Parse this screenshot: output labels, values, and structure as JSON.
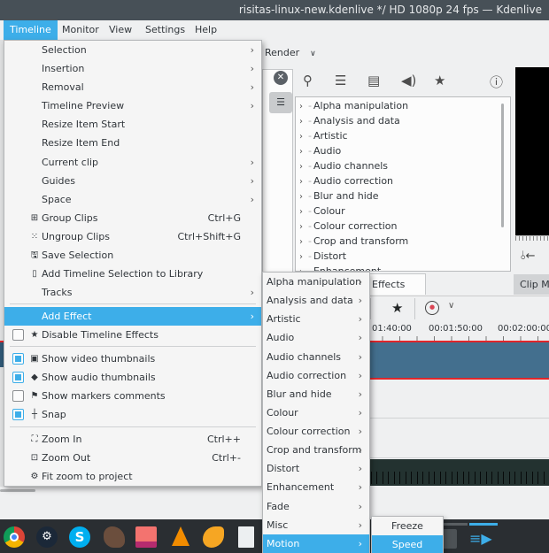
{
  "window": {
    "title": "risitas-linux-new.kdenlive */ HD 1080p 24 fps — Kdenlive"
  },
  "menubar": [
    {
      "label": "Timeline",
      "active": true
    },
    {
      "label": "Monitor"
    },
    {
      "label": "View"
    },
    {
      "label": "Settings"
    },
    {
      "label": "Help"
    }
  ],
  "toolbar": {
    "render_label": "Render"
  },
  "effects_panel": {
    "categories": [
      "Alpha manipulation",
      "Analysis and data",
      "Artistic",
      "Audio",
      "Audio channels",
      "Audio correction",
      "Blur and hide",
      "Colour",
      "Colour correction",
      "Crop and transform",
      "Distort",
      "Enhancement"
    ],
    "icons": [
      "search-icon",
      "list-icon",
      "video-icon",
      "audio-icon",
      "favorite-icon",
      "info-icon"
    ]
  },
  "tabs": {
    "effects": "Effects",
    "clip_monitor": "Clip Monitor"
  },
  "timeline": {
    "ruler_labels": [
      "01:40:00",
      "00:01:50:00",
      "00:02:00:00"
    ]
  },
  "timeline_menu": {
    "items": [
      {
        "label": "Selection",
        "submenu": true
      },
      {
        "label": "Insertion",
        "submenu": true
      },
      {
        "label": "Removal",
        "submenu": true
      },
      {
        "label": "Timeline Preview",
        "submenu": true
      },
      {
        "label": "Resize Item Start"
      },
      {
        "label": "Resize Item End"
      },
      {
        "label": "Current clip",
        "submenu": true
      },
      {
        "label": "Guides",
        "submenu": true
      },
      {
        "label": "Space",
        "submenu": true
      },
      {
        "label": "Group Clips",
        "shortcut": "Ctrl+G",
        "icon": "group-icon"
      },
      {
        "label": "Ungroup Clips",
        "shortcut": "Ctrl+Shift+G",
        "icon": "ungroup-icon"
      },
      {
        "label": "Save Selection",
        "icon": "save-icon"
      },
      {
        "label": "Add Timeline Selection to Library",
        "icon": "bookmark-icon"
      },
      {
        "label": "Tracks",
        "submenu": true
      },
      {
        "label": "Add Effect",
        "submenu": true,
        "highlighted": true
      },
      {
        "label": "Disable Timeline Effects",
        "checkbox": false,
        "icon": "star-icon"
      },
      {
        "label": "Show video thumbnails",
        "checkbox": true,
        "icon": "film-icon"
      },
      {
        "label": "Show audio thumbnails",
        "checkbox": true,
        "icon": "audio-wave-icon"
      },
      {
        "label": "Show markers comments",
        "checkbox": false,
        "icon": "flag-icon"
      },
      {
        "label": "Snap",
        "checkbox": true,
        "icon": "snap-icon"
      },
      {
        "label": "Zoom In",
        "shortcut": "Ctrl++",
        "icon": "zoom-in-icon"
      },
      {
        "label": "Zoom Out",
        "shortcut": "Ctrl+-",
        "icon": "zoom-out-icon"
      },
      {
        "label": "Fit zoom to project",
        "icon": "zoom-fit-icon"
      }
    ]
  },
  "add_effect_menu": {
    "items": [
      "Alpha manipulation",
      "Analysis and data",
      "Artistic",
      "Audio",
      "Audio channels",
      "Audio correction",
      "Blur and hide",
      "Colour",
      "Colour correction",
      "Crop and transform",
      "Distort",
      "Enhancement",
      "Fade",
      "Misc",
      "Motion"
    ],
    "highlighted": "Motion"
  },
  "motion_menu": {
    "items": [
      "Freeze",
      "Speed"
    ],
    "highlighted": "Speed"
  },
  "taskbar": {
    "apps": [
      "chrome-icon",
      "steam-icon",
      "skype-icon",
      "krita-icon",
      "screenshot-icon",
      "vlc-icon",
      "clementine-icon",
      "document-icon"
    ]
  },
  "colors": {
    "accent": "#3daee9",
    "titlebar": "#475057",
    "clip": "#436f8e",
    "playhead": "#e0262a"
  }
}
